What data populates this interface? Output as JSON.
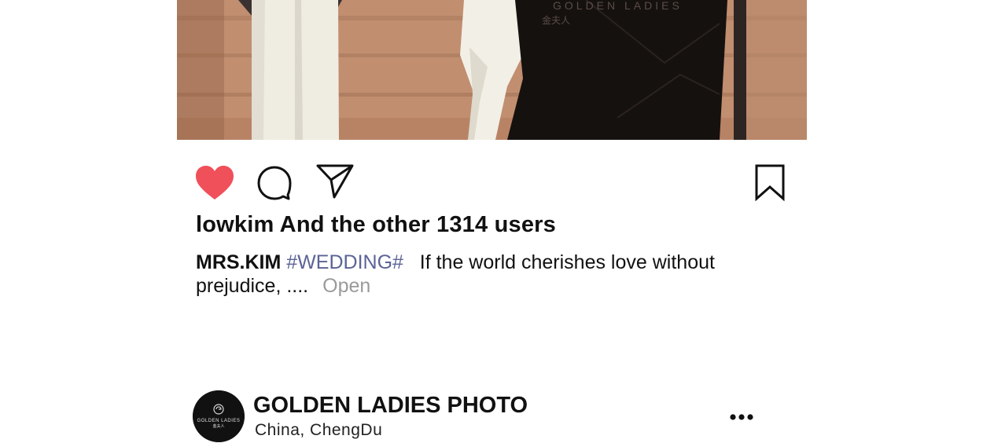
{
  "post": {
    "image_watermark": "GOLDEN LADIES",
    "image_watermark_sub": "金夫人"
  },
  "actions": {
    "like_icon": "heart-filled-icon",
    "comment_icon": "comment-bubble-icon",
    "share_icon": "paper-plane-icon",
    "bookmark_icon": "bookmark-icon",
    "like_color": "#f0505a"
  },
  "likes": {
    "text": "lowkim And the other 1314 users"
  },
  "caption": {
    "author": "MRS.KIM",
    "hashtag": "#WEDDING#",
    "text": "If the world cherishes love without prejudice, ....",
    "open_label": "Open",
    "hashtag_color": "#5b6396"
  },
  "account": {
    "name": "GOLDEN LADIES PHOTO",
    "location": "China,  ChengDu",
    "avatar_brand": "GOLDEN LADIES",
    "avatar_brand_sub": "金夫人",
    "more_icon": "more-dots-icon"
  }
}
